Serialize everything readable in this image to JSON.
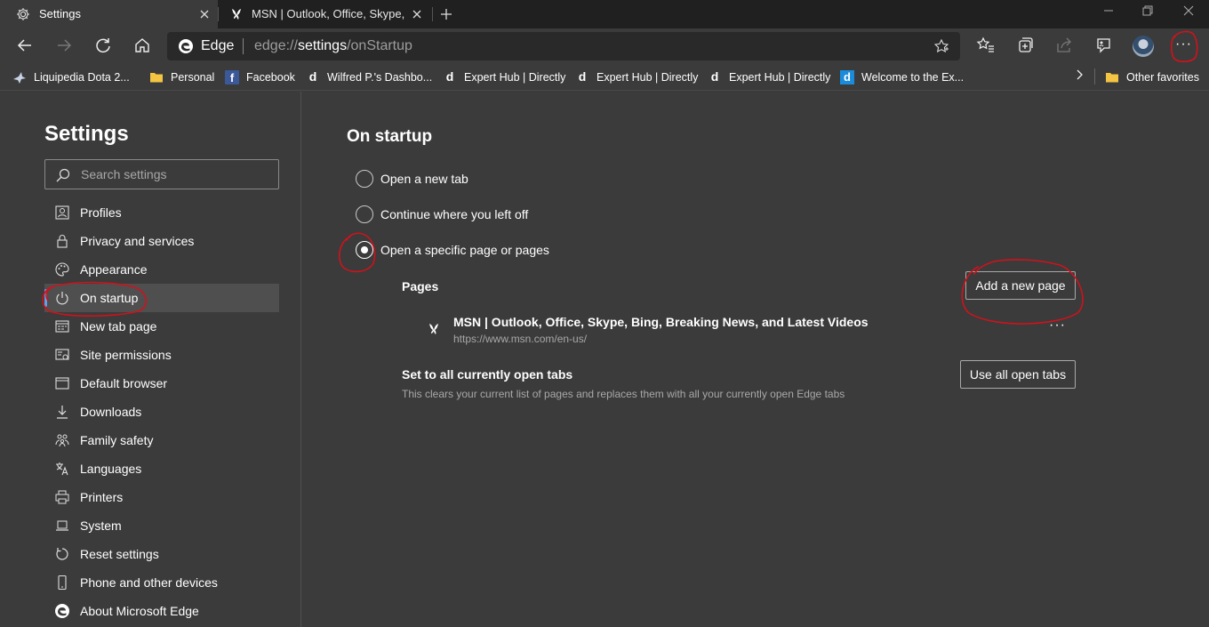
{
  "tabs": [
    {
      "title": "Settings",
      "icon": "gear-icon",
      "active": true
    },
    {
      "title": "MSN | Outlook, Office, Skype, Bing, Breaking News, and Latest Videos",
      "icon": "msn-butterfly-icon",
      "active": false
    }
  ],
  "address_bar": {
    "site_label": "Edge",
    "url_prefix": "edge://",
    "url_host": "settings",
    "url_path": "/onStartup"
  },
  "favorites": [
    {
      "label": "Liquipedia Dota 2...",
      "icon": "liquipedia-icon"
    },
    {
      "label": "Personal",
      "icon": "folder-icon"
    },
    {
      "label": "Facebook",
      "icon": "facebook-icon"
    },
    {
      "label": "Wilfred P.'s Dashbo...",
      "icon": "directly-d-icon"
    },
    {
      "label": "Expert Hub | Directly",
      "icon": "directly-d-icon"
    },
    {
      "label": "Expert Hub | Directly",
      "icon": "directly-d-icon"
    },
    {
      "label": "Expert Hub | Directly",
      "icon": "directly-d-icon"
    },
    {
      "label": "Welcome to the Ex...",
      "icon": "directly-blue-d-icon"
    }
  ],
  "other_favorites": "Other favorites",
  "sidebar": {
    "title": "Settings",
    "search_placeholder": "Search settings",
    "items": [
      {
        "label": "Profiles",
        "icon": "profile-icon"
      },
      {
        "label": "Privacy and services",
        "icon": "lock-icon"
      },
      {
        "label": "Appearance",
        "icon": "palette-icon"
      },
      {
        "label": "On startup",
        "icon": "power-icon",
        "selected": true
      },
      {
        "label": "New tab page",
        "icon": "new-tab-icon"
      },
      {
        "label": "Site permissions",
        "icon": "site-permissions-icon"
      },
      {
        "label": "Default browser",
        "icon": "browser-icon"
      },
      {
        "label": "Downloads",
        "icon": "download-icon"
      },
      {
        "label": "Family safety",
        "icon": "family-icon"
      },
      {
        "label": "Languages",
        "icon": "languages-icon"
      },
      {
        "label": "Printers",
        "icon": "printer-icon"
      },
      {
        "label": "System",
        "icon": "laptop-icon"
      },
      {
        "label": "Reset settings",
        "icon": "reset-icon"
      },
      {
        "label": "Phone and other devices",
        "icon": "phone-icon"
      },
      {
        "label": "About Microsoft Edge",
        "icon": "edge-icon"
      }
    ]
  },
  "main": {
    "title": "On startup",
    "options": [
      {
        "label": "Open a new tab",
        "checked": false
      },
      {
        "label": "Continue where you left off",
        "checked": false
      },
      {
        "label": "Open a specific page or pages",
        "checked": true
      }
    ],
    "pages_heading": "Pages",
    "add_page_button": "Add a new page",
    "pages": [
      {
        "title": "MSN | Outlook, Office, Skype, Bing, Breaking News, and Latest Videos",
        "url": "https://www.msn.com/en-us/"
      }
    ],
    "page_more": "···",
    "set_open_heading": "Set to all currently open tabs",
    "set_open_desc": "This clears your current list of pages and replaces them with all your currently open Edge tabs",
    "use_open_tabs_button": "Use all open tabs"
  },
  "toolbar_more": "···",
  "colors": {
    "background": "#3b3b3b",
    "tabstrip": "#202020",
    "accent": "#5ea2e8",
    "annotation": "#d0121b"
  }
}
